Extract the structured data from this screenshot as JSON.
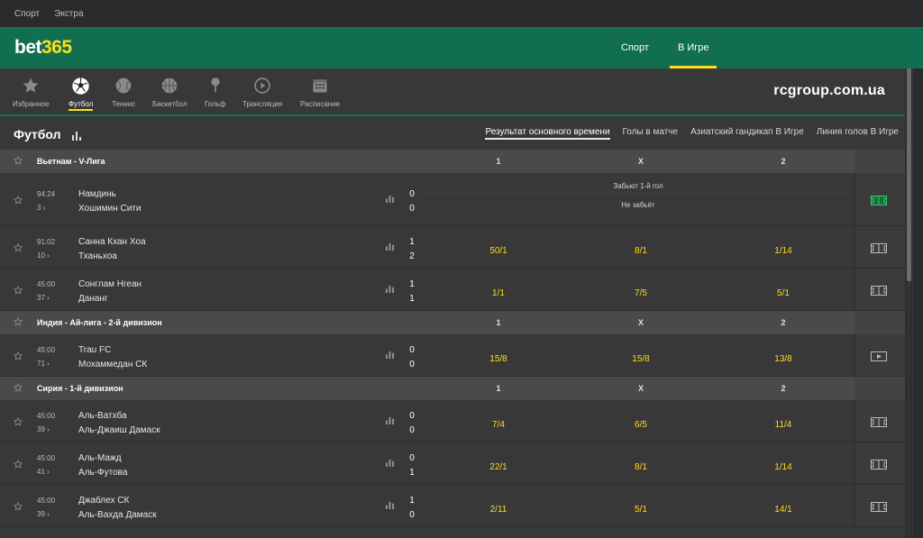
{
  "topbar": {
    "links": [
      "Спорт",
      "Экстра"
    ]
  },
  "header": {
    "logo_main": "bet",
    "logo_num": "365",
    "nav": [
      {
        "label": "Спорт",
        "active": false
      },
      {
        "label": "В Игре",
        "active": true
      }
    ]
  },
  "sports": [
    {
      "label": "Избранное",
      "icon": "star-icon",
      "active": false
    },
    {
      "label": "Футбол",
      "icon": "soccer-ball-icon",
      "active": true
    },
    {
      "label": "Теннис",
      "icon": "tennis-ball-icon",
      "active": false
    },
    {
      "label": "Баскетбол",
      "icon": "basketball-icon",
      "active": false
    },
    {
      "label": "Гольф",
      "icon": "golf-icon",
      "active": false
    },
    {
      "label": "Трансляция",
      "icon": "play-icon",
      "active": false
    },
    {
      "label": "Расписание",
      "icon": "calendar-icon",
      "active": false
    }
  ],
  "watermark": "rcgroup.com.ua",
  "page_title": "Футбол",
  "market_tabs": [
    {
      "label": "Результат основного времени",
      "active": true
    },
    {
      "label": "Голы в матче",
      "active": false
    },
    {
      "label": "Азиатский гандикап В Игре",
      "active": false
    },
    {
      "label": "Линия голов В Игре",
      "active": false
    }
  ],
  "columns": {
    "c1": "1",
    "cx": "X",
    "c2": "2"
  },
  "leagues": [
    {
      "name": "Вьетнам - V-Лига",
      "matches": [
        {
          "time": "94:24",
          "period": "3",
          "home": "Намдинь",
          "away": "Хошимин Сити",
          "score_home": "0",
          "score_away": "0",
          "special": {
            "line1": "Забьют 1-й гол",
            "line2": "Не забьёт"
          },
          "icon": "pitch-active-icon"
        },
        {
          "time": "91:02",
          "period": "10",
          "home": "Санна Кхан Хоа",
          "away": "Тханьхоа",
          "score_home": "1",
          "score_away": "2",
          "odds": [
            "50/1",
            "8/1",
            "1/14"
          ],
          "icon": "pitch-icon"
        },
        {
          "time": "45:00",
          "period": "37",
          "home": "Сонглам Нгеан",
          "away": "Дананг",
          "score_home": "1",
          "score_away": "1",
          "odds": [
            "1/1",
            "7/5",
            "5/1"
          ],
          "icon": "pitch-icon"
        }
      ]
    },
    {
      "name": "Индия - Ай-лига - 2-й дивизион",
      "matches": [
        {
          "time": "45:00",
          "period": "71",
          "home": "Trau FC",
          "away": "Мохаммедан СК",
          "score_home": "0",
          "score_away": "0",
          "odds": [
            "15/8",
            "15/8",
            "13/8"
          ],
          "icon": "video-icon"
        }
      ]
    },
    {
      "name": "Сирия - 1-й дивизион",
      "matches": [
        {
          "time": "45:00",
          "period": "39",
          "home": "Аль-Ватхба",
          "away": "Аль-Джаиш Дамаск",
          "score_home": "0",
          "score_away": "0",
          "odds": [
            "7/4",
            "6/5",
            "11/4"
          ],
          "icon": "pitch-icon"
        },
        {
          "time": "45:00",
          "period": "41",
          "home": "Аль-Мажд",
          "away": "Аль-Футова",
          "score_home": "0",
          "score_away": "1",
          "odds": [
            "22/1",
            "8/1",
            "1/14"
          ],
          "icon": "pitch-icon"
        },
        {
          "time": "45:00",
          "period": "39",
          "home": "Джаблех СК",
          "away": "Аль-Вахда Дамаск",
          "score_home": "1",
          "score_away": "0",
          "odds": [
            "2/11",
            "5/1",
            "14/1"
          ],
          "icon": "pitch-icon"
        }
      ]
    }
  ]
}
